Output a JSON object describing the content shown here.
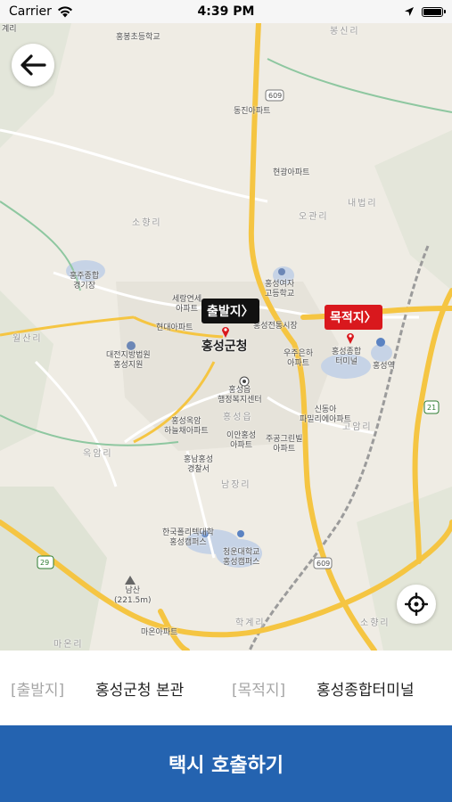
{
  "status_bar": {
    "carrier": "Carrier",
    "time": "4:39 PM",
    "battery_level": 1.0
  },
  "map": {
    "labels": [
      {
        "id": "gyeri",
        "text": "계리"
      },
      {
        "id": "bongsin",
        "text": "봉신리"
      },
      {
        "id": "hongbong",
        "text": "홍봉초등학교"
      },
      {
        "id": "road609a",
        "text": "609"
      },
      {
        "id": "dongjin",
        "text": "동진아파트"
      },
      {
        "id": "hyeongwang",
        "text": "현광아파트"
      },
      {
        "id": "naebeop",
        "text": "내법리"
      },
      {
        "id": "sohyang",
        "text": "소향리"
      },
      {
        "id": "ohgwanri",
        "text": "오관리"
      },
      {
        "id": "hongju_stadium",
        "text": "홍주종합\n경기장"
      },
      {
        "id": "hongseong_girls",
        "text": "홍성여자\n고등학교"
      },
      {
        "id": "serang",
        "text": "세랑연세\n아파트"
      },
      {
        "id": "hyundai_apt",
        "text": "현대아파트"
      },
      {
        "id": "jeonmun",
        "text": "홍성전통시장"
      },
      {
        "id": "daejeon_court",
        "text": "대전지방법원\n홍성지원"
      },
      {
        "id": "county_office",
        "text": "홍성군청"
      },
      {
        "id": "wooju",
        "text": "우주은하\n아파트"
      },
      {
        "id": "terminal",
        "text": "홍성종합\n터미널"
      },
      {
        "id": "station",
        "text": "홍성역"
      },
      {
        "id": "oksanri",
        "text": "월산리"
      },
      {
        "id": "welfare_center",
        "text": "홍성읍\n행정복지센터"
      },
      {
        "id": "hongseong_eup",
        "text": "홍성읍"
      },
      {
        "id": "sindongah",
        "text": "신동아\n파밀리에아파트"
      },
      {
        "id": "okam_haneul",
        "text": "홍성옥암\n하늘채아파트"
      },
      {
        "id": "ian",
        "text": "이안홍성\n아파트"
      },
      {
        "id": "jugong",
        "text": "주공그린빌\n아파트"
      },
      {
        "id": "goam",
        "text": "고암리"
      },
      {
        "id": "police",
        "text": "홍남홍성\n경찰서"
      },
      {
        "id": "okam_ri",
        "text": "옥암리"
      },
      {
        "id": "namjang",
        "text": "남장리"
      },
      {
        "id": "polytech",
        "text": "한국폴리텍대학\n홍성캠퍼스"
      },
      {
        "id": "cheongun",
        "text": "청운대학교\n홍성캠퍼스"
      },
      {
        "id": "road609b",
        "text": "609"
      },
      {
        "id": "road29",
        "text": "29"
      },
      {
        "id": "road21",
        "text": "21"
      },
      {
        "id": "namsan",
        "text": "남산\n(221.5m)"
      },
      {
        "id": "maon_apt",
        "text": "마온아파트"
      },
      {
        "id": "hakgye",
        "text": "학계리"
      },
      {
        "id": "sohyang2",
        "text": "소향리"
      },
      {
        "id": "maonri",
        "text": "마온리"
      }
    ]
  },
  "markers": {
    "origin_label": "출발지〉",
    "destination_label": "목적지〉"
  },
  "trip": {
    "origin_tag": "[출발지]",
    "origin_value": "홍성군청 본관",
    "destination_tag": "[목적지]",
    "destination_value": "홍성종합터미널"
  },
  "call_button_label": "택시 호출하기",
  "icons": {
    "back": "arrow-left-icon",
    "locate": "crosshair-icon",
    "wifi": "wifi-icon",
    "location": "location-arrow-icon"
  },
  "colors": {
    "call_button": "#2463b0",
    "origin_marker": "#111111",
    "destination_marker": "#d9181d",
    "road_major": "#f5c542",
    "tag_gray": "#a6a6a6"
  }
}
